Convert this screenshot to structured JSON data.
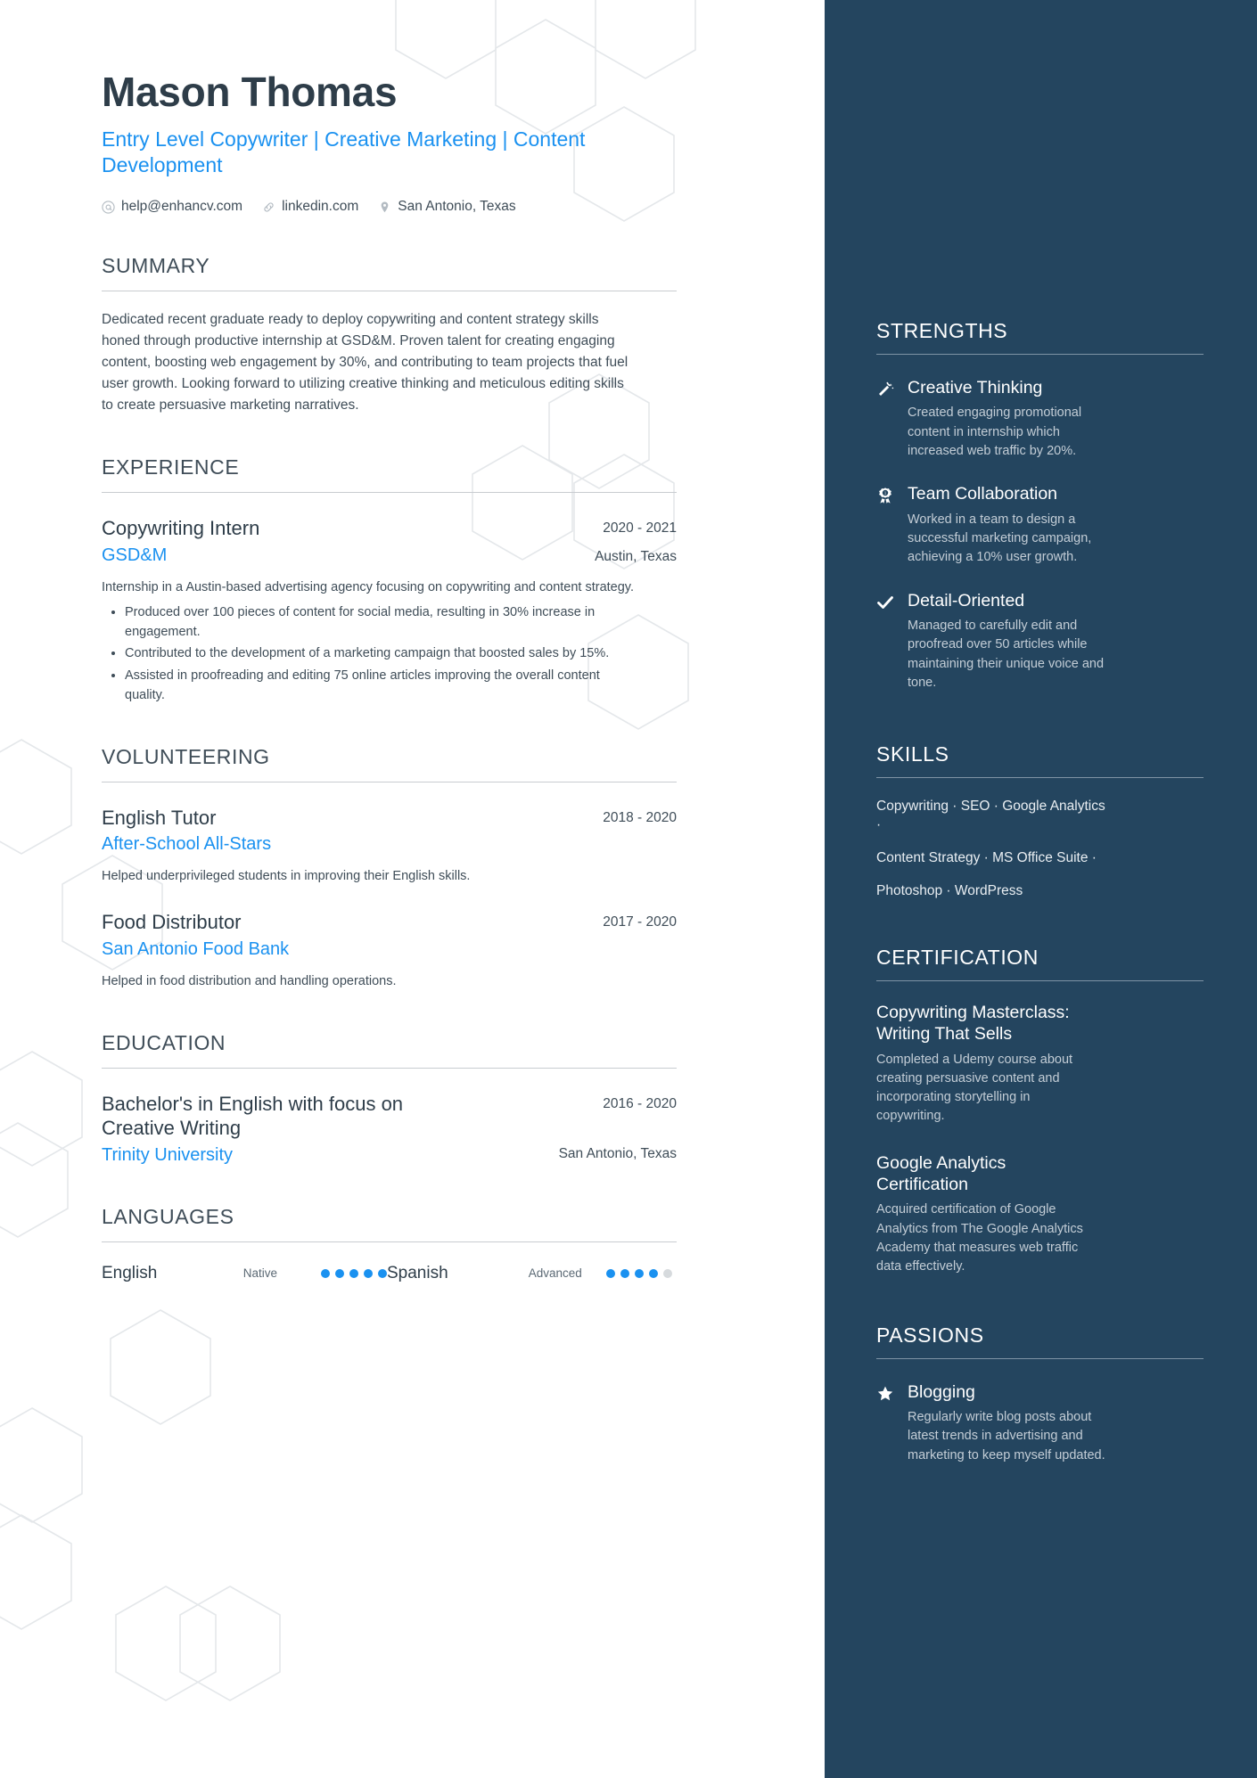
{
  "header": {
    "name": "Mason Thomas",
    "headline": "Entry Level Copywriter | Creative Marketing | Content Development",
    "contacts": [
      {
        "icon": "email-icon",
        "text": "help@enhancv.com"
      },
      {
        "icon": "link-icon",
        "text": "linkedin.com"
      },
      {
        "icon": "location-pin-icon",
        "text": "San Antonio, Texas"
      }
    ]
  },
  "summary": {
    "title": "SUMMARY",
    "text": "Dedicated recent graduate ready to deploy copywriting and content strategy skills honed through productive internship at GSD&M. Proven talent for creating engaging content, boosting web engagement by 30%, and contributing to team projects that fuel user growth. Looking forward to utilizing creative thinking and meticulous editing skills to create persuasive marketing narratives."
  },
  "experience": {
    "title": "EXPERIENCE",
    "entries": [
      {
        "role": "Copywriting Intern",
        "company": "GSD&M",
        "date": "2020 - 2021",
        "location": "Austin, Texas",
        "description": "Internship in a Austin-based advertising agency focusing on copywriting and content strategy.",
        "bullets": [
          "Produced over 100 pieces of content for social media, resulting in 30% increase in engagement.",
          "Contributed to the development of a marketing campaign that boosted sales by 15%.",
          "Assisted in proofreading and editing 75 online articles improving the overall content quality."
        ]
      }
    ]
  },
  "volunteering": {
    "title": "VOLUNTEERING",
    "entries": [
      {
        "role": "English Tutor",
        "company": "After-School All-Stars",
        "date": "2018 - 2020",
        "location": "",
        "description": "Helped underprivileged students in improving their English skills."
      },
      {
        "role": "Food Distributor",
        "company": "San Antonio Food Bank",
        "date": "2017 - 2020",
        "location": "",
        "description": "Helped in food distribution and handling operations."
      }
    ]
  },
  "education": {
    "title": "EDUCATION",
    "entries": [
      {
        "degree": "Bachelor's in English with focus on Creative Writing",
        "school": "Trinity University",
        "date": "2016 - 2020",
        "location": "San Antonio, Texas"
      }
    ]
  },
  "languages": {
    "title": "LANGUAGES",
    "items": [
      {
        "name": "English",
        "level": "Native",
        "filled": 5,
        "total": 5
      },
      {
        "name": "Spanish",
        "level": "Advanced",
        "filled": 4,
        "total": 5
      }
    ]
  },
  "strengths": {
    "title": "STRENGTHS",
    "items": [
      {
        "icon": "magic-wand-icon",
        "name": "Creative Thinking",
        "description": "Created engaging promotional content in internship which increased web traffic by 20%."
      },
      {
        "icon": "award-medal-icon",
        "name": "Team Collaboration",
        "description": "Worked in a team to design a successful marketing campaign, achieving a 10% user growth."
      },
      {
        "icon": "checkmark-icon",
        "name": "Detail-Oriented",
        "description": "Managed to carefully edit and proofread over 50 articles while maintaining their unique voice and tone."
      }
    ]
  },
  "skills": {
    "title": "SKILLS",
    "lines": [
      "Copywriting · SEO · Google Analytics ·",
      "Content Strategy · MS Office Suite ·",
      "Photoshop · WordPress"
    ]
  },
  "certification": {
    "title": "CERTIFICATION",
    "items": [
      {
        "name": "Copywriting Masterclass: Writing That Sells",
        "description": "Completed a Udemy course about creating persuasive content and incorporating storytelling in copywriting."
      },
      {
        "name": "Google Analytics Certification",
        "description": "Acquired certification of Google Analytics from The Google Analytics Academy that measures web traffic data effectively."
      }
    ]
  },
  "passions": {
    "title": "PASSIONS",
    "items": [
      {
        "icon": "star-icon",
        "name": "Blogging",
        "description": "Regularly write blog posts about latest trends in advertising and marketing to keep myself updated."
      }
    ]
  },
  "colors": {
    "accent": "#1a91f0",
    "sidebar_bg": "#24455f",
    "text_dark": "#2e3d49",
    "text_body": "#3f4d58"
  }
}
